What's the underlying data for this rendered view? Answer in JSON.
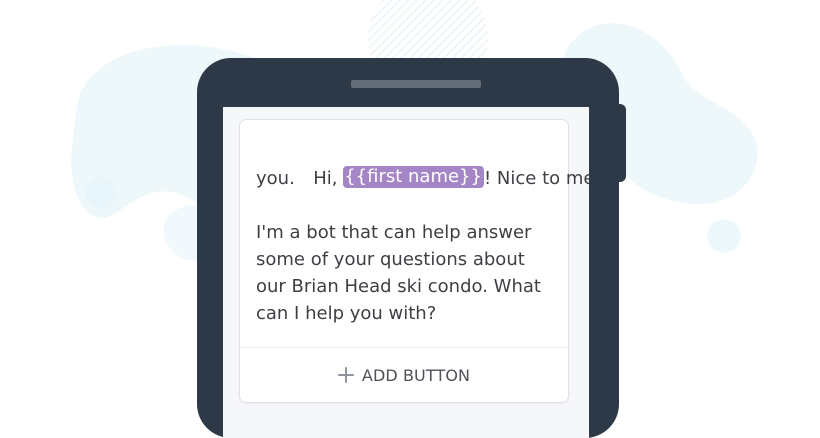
{
  "message": {
    "greeting_prefix": "Hi, ",
    "variable_token": "{{first name}}",
    "greeting_suffix": "! Nice to meet",
    "line_2": "you.",
    "line_4": "I'm a bot that can help answer",
    "line_5": "some of your questions about",
    "line_6": "our Brian Head ski condo. What",
    "line_7": "can I help you with?"
  },
  "actions": {
    "add_button_label": "ADD BUTTON"
  },
  "icons": {
    "add_button_icon": "plus-icon"
  },
  "colors": {
    "phone_body": "#2e3948",
    "speaker": "#636c77",
    "variable_chip": "#a486c6",
    "screen_background": "#f6f7f8",
    "card_background": "#ffffff",
    "decorative_blob": "#eef8fb"
  }
}
